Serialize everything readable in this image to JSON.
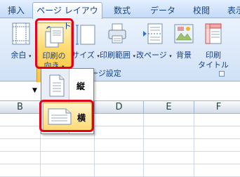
{
  "tabs": [
    {
      "label": "挿入",
      "active": false
    },
    {
      "label": "ページ レイアウト",
      "active": true
    },
    {
      "label": "数式",
      "active": false
    },
    {
      "label": "データ",
      "active": false
    },
    {
      "label": "校閲",
      "active": false
    },
    {
      "label": "表示",
      "active": false
    }
  ],
  "ribbon": {
    "margins": {
      "label": "余白",
      "arrow": "▾"
    },
    "orientation": {
      "label_line1": "印刷の",
      "label_line2": "向き",
      "arrow": "▾"
    },
    "size": {
      "label": "サイズ",
      "arrow": "▾"
    },
    "print_area": {
      "label": "印刷範囲",
      "arrow": "▾"
    },
    "page_break": {
      "label": "改ページ",
      "arrow": "▾"
    },
    "background": {
      "label": "背景"
    },
    "print_titles": {
      "label_line1": "印刷",
      "label_line2": "タイトル"
    },
    "group_label": "ページ設定"
  },
  "orientation_menu": {
    "portrait_label": "縦",
    "landscape_label": "横",
    "selected": "横"
  },
  "columns": [
    "B",
    "C",
    "D",
    "E",
    "F"
  ],
  "colors": {
    "highlight": "#e3001b",
    "hover": "#ffd96b"
  }
}
